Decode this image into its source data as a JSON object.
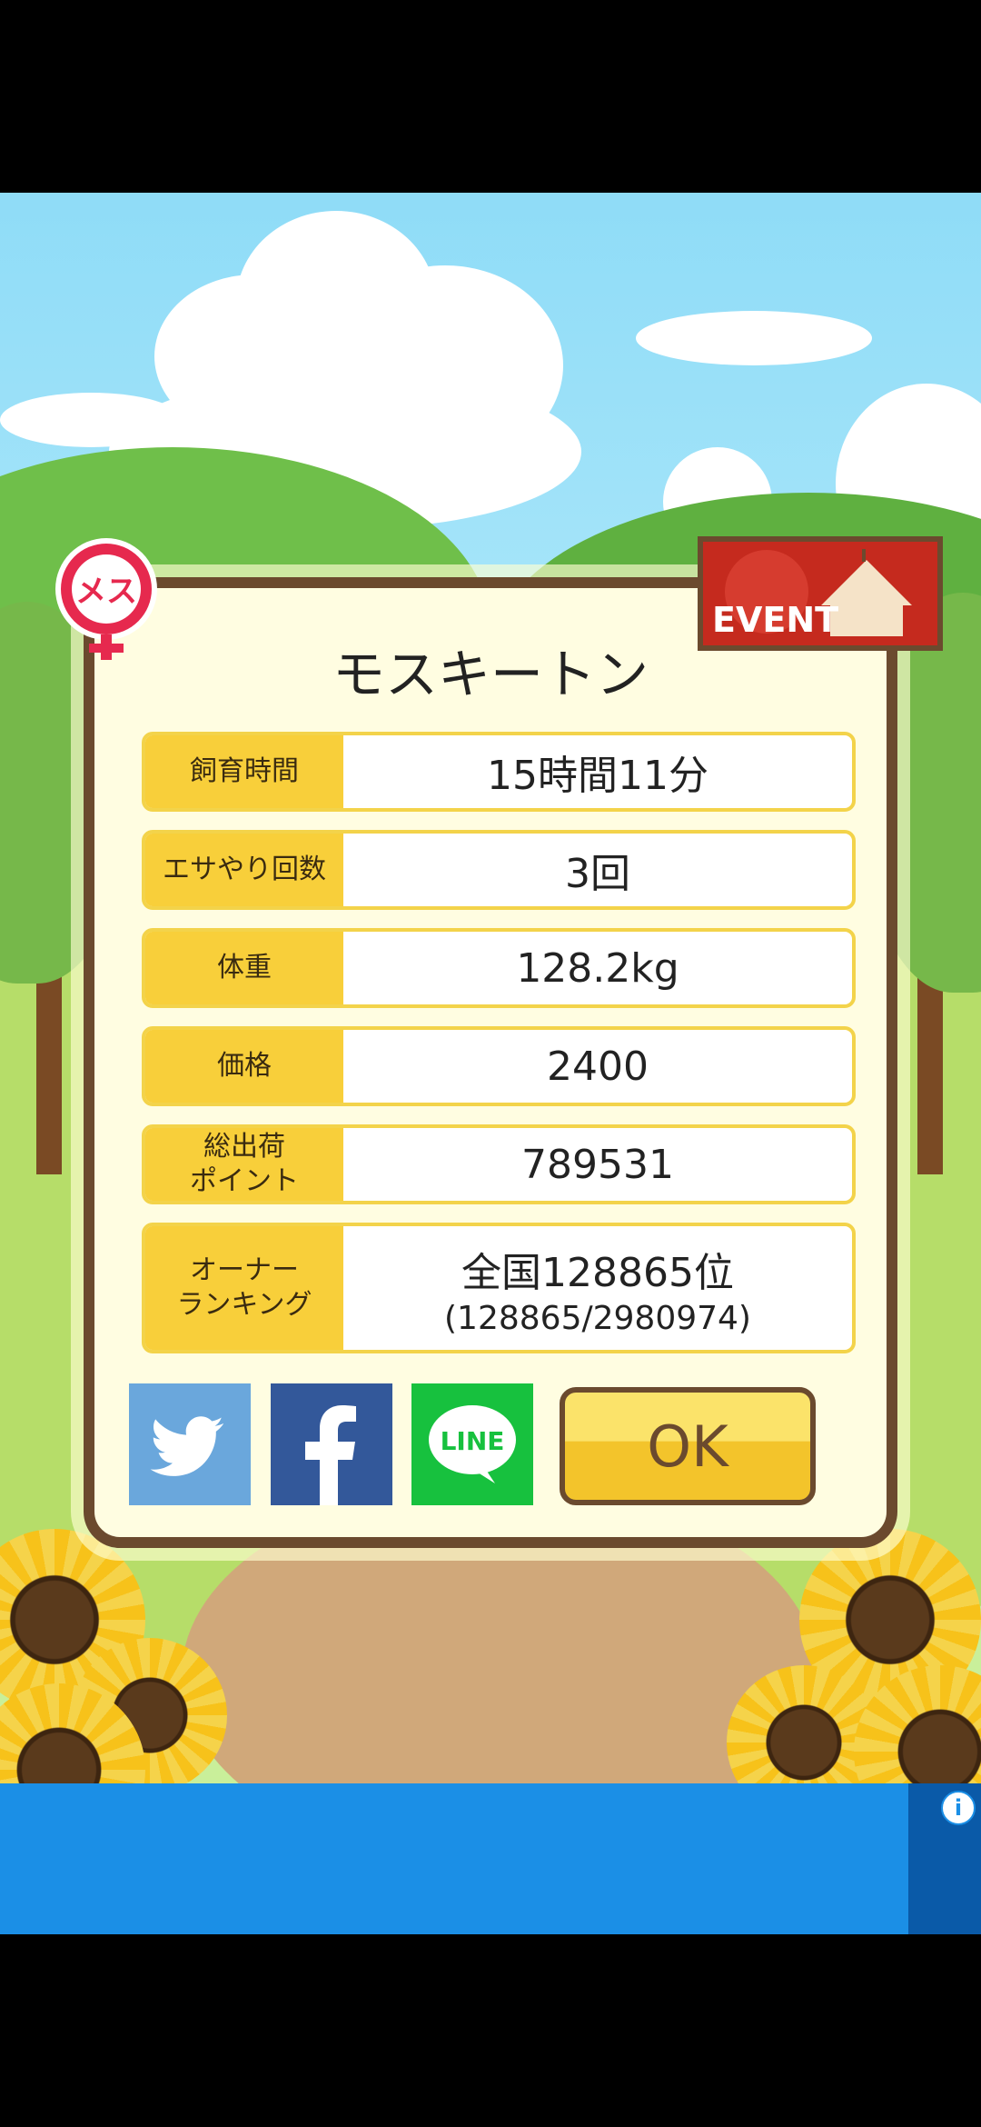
{
  "dialog": {
    "title": "モスキートン",
    "rows": [
      {
        "label": "飼育時間",
        "value": "15時間11分"
      },
      {
        "label": "エサやり回数",
        "value": "3回"
      },
      {
        "label": "体重",
        "value": "128.2kg"
      },
      {
        "label": "価格",
        "value": "2400"
      },
      {
        "label": "総出荷\nポイント",
        "value": "789531"
      },
      {
        "label": "オーナー\nランキング",
        "value": "全国128865位",
        "sub": "(128865/2980974)"
      }
    ],
    "ok_label": "OK"
  },
  "badges": {
    "gender": "メス",
    "event": "EVENT"
  },
  "share": {
    "line_label": "LINE"
  },
  "ad": {
    "info": "i"
  }
}
